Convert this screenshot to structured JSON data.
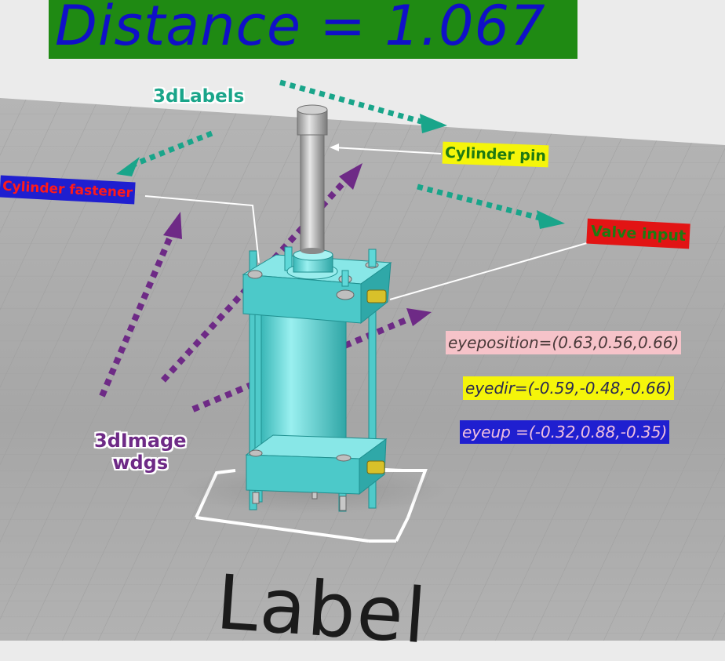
{
  "banner": {
    "text": "Distance  =  1.067"
  },
  "labels3d_caption": "3dLabels",
  "image_widgets_caption": {
    "line1": "3dImage",
    "line2": "wdgs"
  },
  "tags": {
    "cylinder_pin": "Cylinder pin",
    "cylinder_fastener": "Cylinder fastener",
    "valve_input": "Valve input"
  },
  "camera": {
    "eyeposition": "eyeposition=(0.63,0.56,0.66)",
    "eyedir": "eyedir=(-0.59,-0.48,-0.66)",
    "eyeup": "eyeup =(-0.32,0.88,-0.35)"
  },
  "floor_label": "Label",
  "colors": {
    "banner_bg": "#1f8a13",
    "banner_text": "#1010c8",
    "cylinder": "#5fd8d8",
    "teal_arrow": "#19a58a",
    "purple_arrow": "#6e2a86",
    "floor": "#a9a9a9",
    "sky": "#ebebeb"
  }
}
